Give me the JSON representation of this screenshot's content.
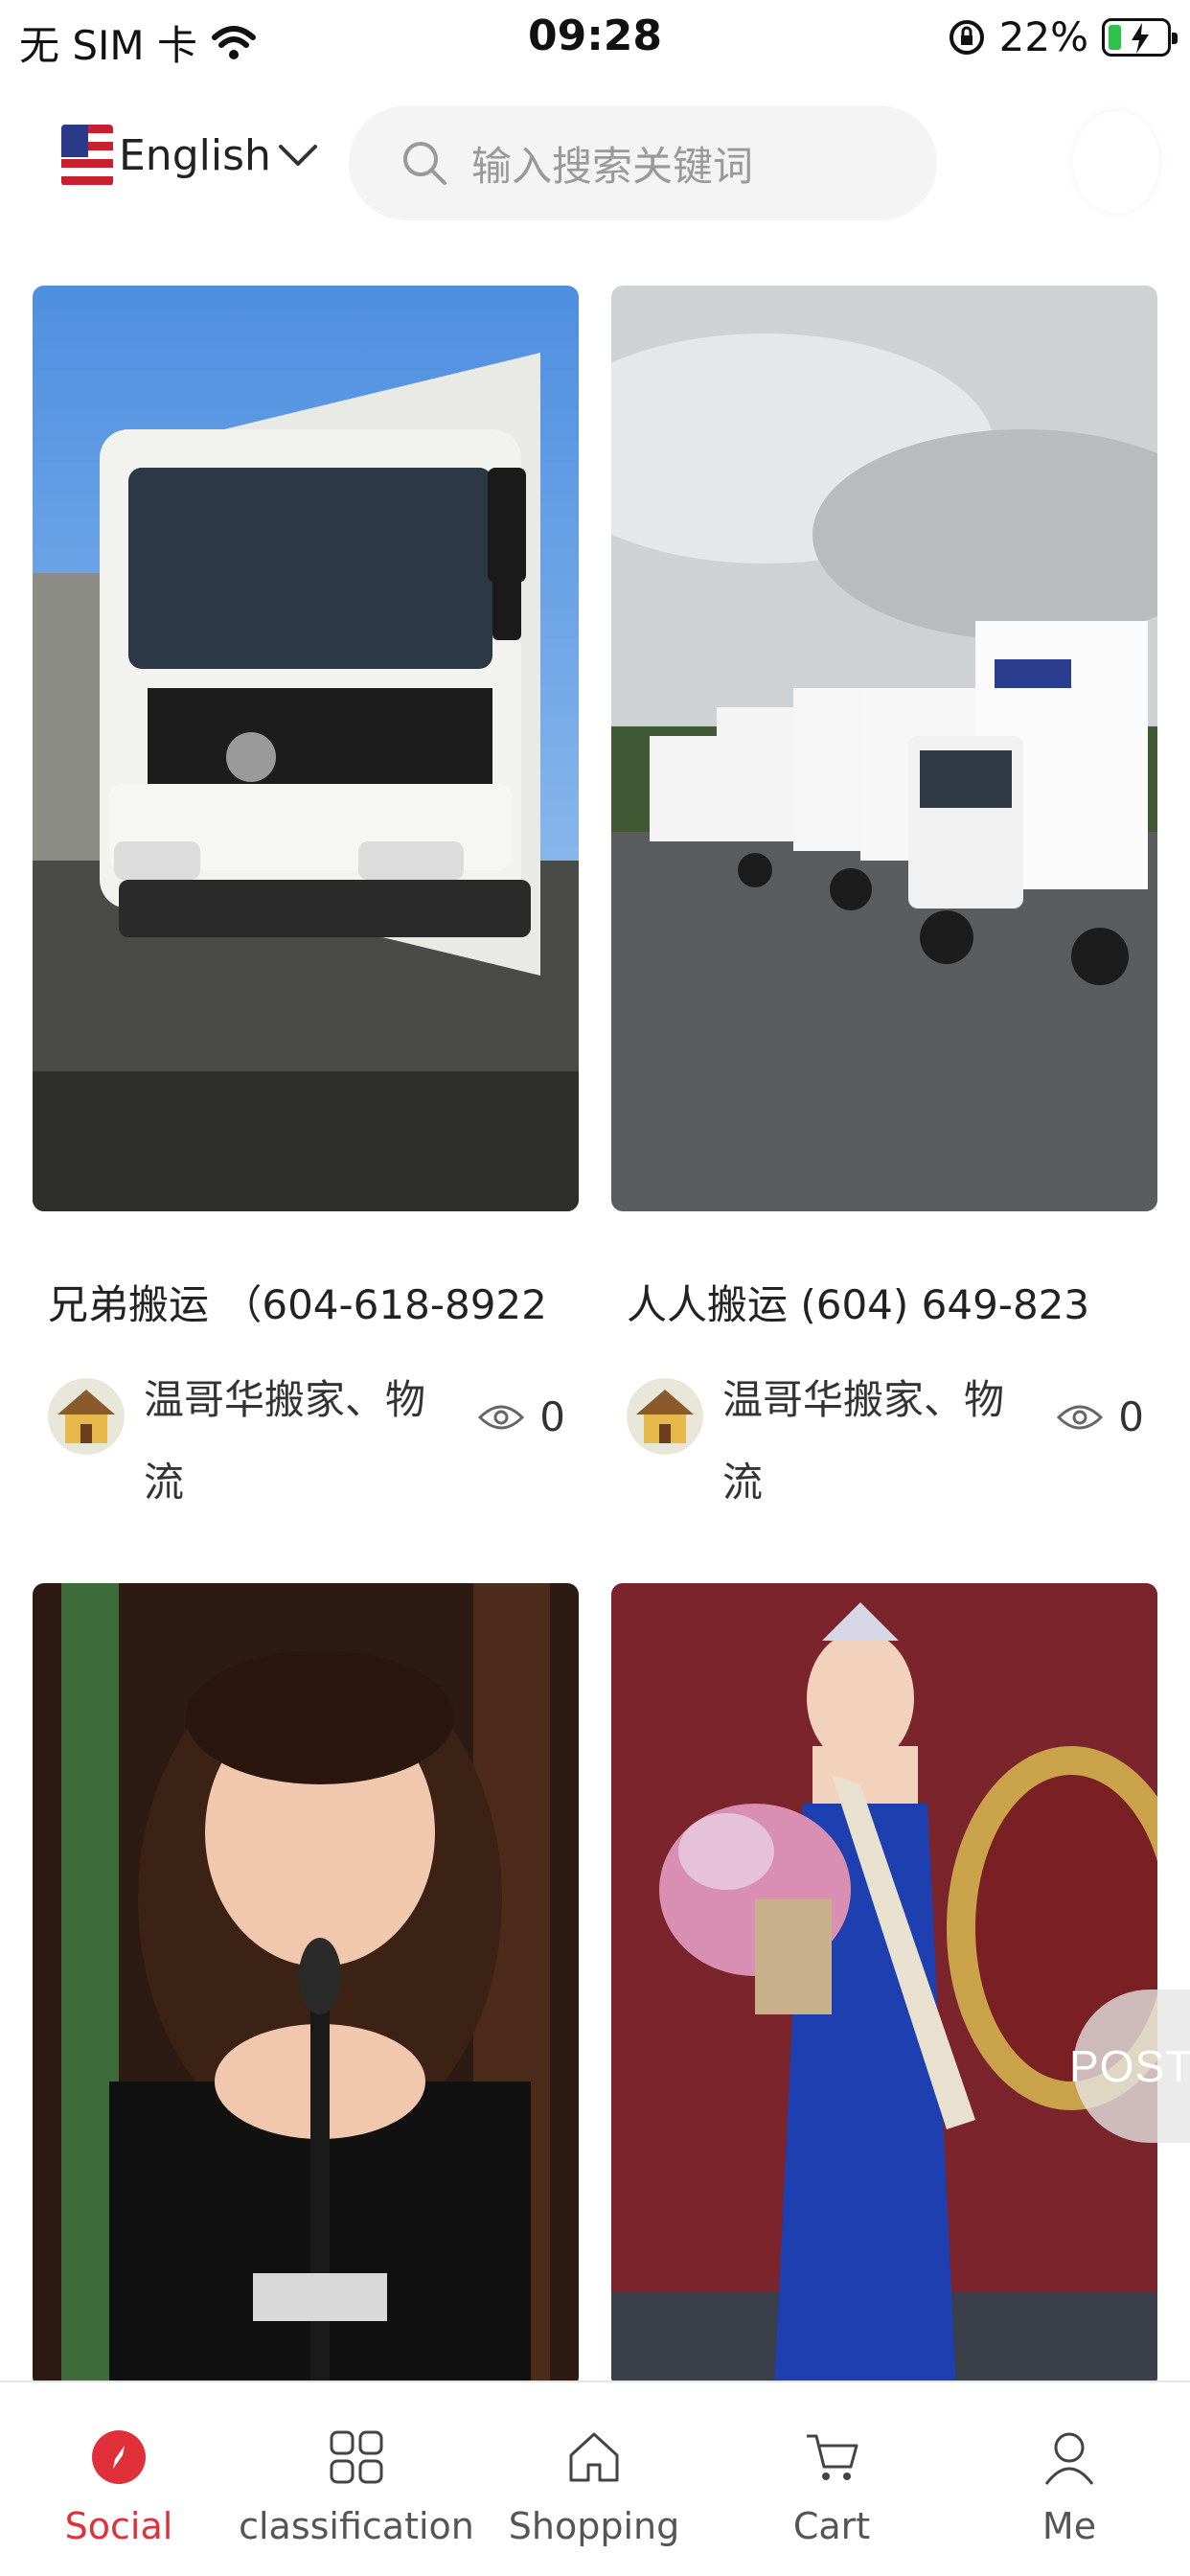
{
  "status_bar": {
    "carrier": "无 SIM 卡",
    "time": "09:28",
    "battery": "22%",
    "battery_level": 0.22,
    "icons": [
      "wifi-icon",
      "orientation-lock-icon",
      "battery-icon"
    ]
  },
  "header": {
    "language": "English",
    "search_placeholder": "输入搜索关键词",
    "icons": [
      "us-flag-icon",
      "chevron-down-icon",
      "search-icon"
    ]
  },
  "cards": [
    {
      "title": "兄弟搬运 （604-618-8922",
      "author": "温哥华搬家、物流",
      "views": "0",
      "image": "white-box-truck-photo"
    },
    {
      "title": "人人搬运 (604) 649-823",
      "author": "温哥华搬家、物流",
      "views": "0",
      "image": "moving-truck-fleet-photo"
    },
    {
      "image": "woman-speaking-at-microphone-photo"
    },
    {
      "image": "pageant-winner-with-bouquet-photo"
    }
  ],
  "post_button": {
    "label": "POST"
  },
  "tabbar": {
    "active_color": "#e0313a",
    "items": [
      {
        "label": "Social",
        "icon": "compass-icon",
        "active": true
      },
      {
        "label": "classification",
        "icon": "grid-icon",
        "active": false
      },
      {
        "label": "Shopping",
        "icon": "home-icon",
        "active": false
      },
      {
        "label": "Cart",
        "icon": "cart-icon",
        "active": false
      },
      {
        "label": "Me",
        "icon": "user-icon",
        "active": false
      }
    ]
  }
}
